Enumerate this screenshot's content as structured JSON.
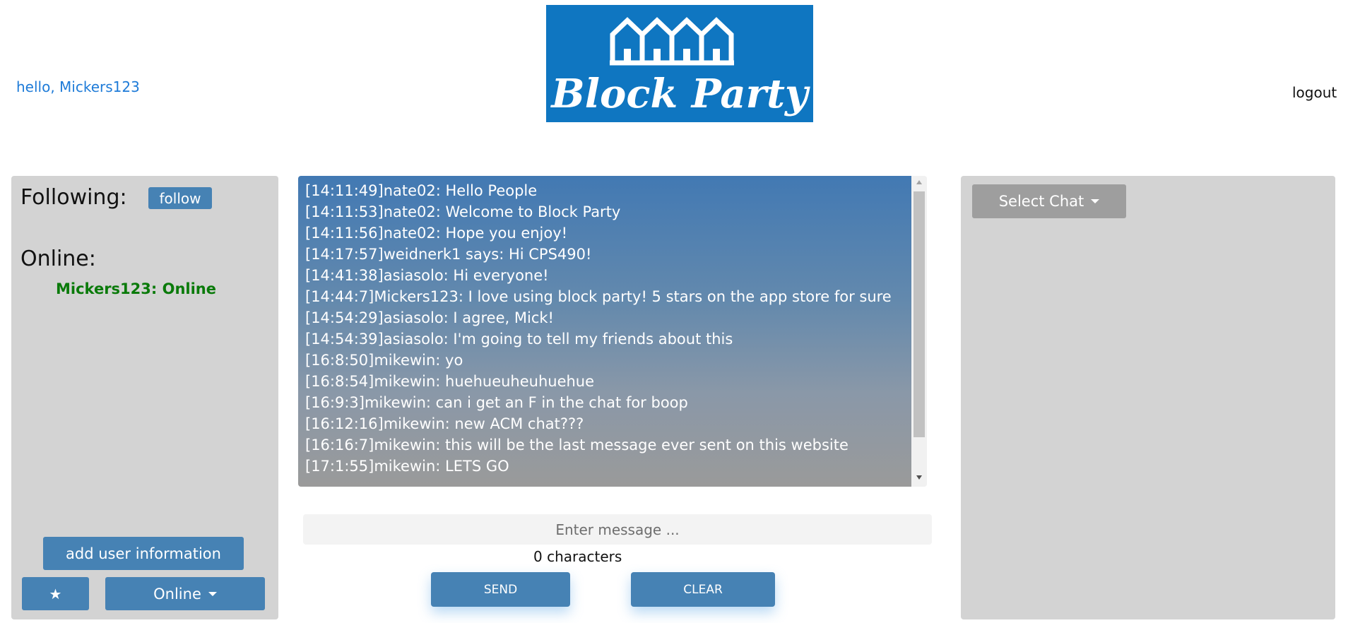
{
  "header": {
    "greeting": "hello, Mickers123",
    "logo_text": "Block Party",
    "logout_label": "logout"
  },
  "left_panel": {
    "following_title": "Following:",
    "follow_label": "follow",
    "online_title": "Online:",
    "online_users": [
      "Mickers123: Online"
    ],
    "add_info_label": "add user information",
    "star_label": "★",
    "status_label": "Online"
  },
  "chat": {
    "messages": [
      "[14:11:49]nate02: Hello People",
      "[14:11:53]nate02: Welcome to Block Party",
      "[14:11:56]nate02: Hope you enjoy!",
      "[14:17:57]weidnerk1 says: Hi CPS490!",
      "[14:41:38]asiasolo: Hi everyone!",
      "[14:44:7]Mickers123: I love using block party! 5 stars on the app store for sure",
      "[14:54:29]asiasolo: I agree, Mick!",
      "[14:54:39]asiasolo: I'm going to tell my friends about this",
      "[16:8:50]mikewin: yo",
      "[16:8:54]mikewin: huehueuheuhuehue",
      "[16:9:3]mikewin: can i get an F in the chat for boop",
      "[16:12:16]mikewin: new ACM chat???",
      "[16:16:7]mikewin: this will be the last message ever sent on this website",
      "[17:1:55]mikewin: LETS GO"
    ],
    "input_placeholder": "Enter message ...",
    "char_count": "0 characters",
    "send_label": "SEND",
    "clear_label": "CLEAR"
  },
  "right_panel": {
    "select_chat_label": "Select Chat"
  },
  "colors": {
    "accent": "#4682b4",
    "logo_bg": "#0f76c1",
    "panel_bg": "#d3d3d3",
    "online_green": "#0a7a0a",
    "greeting_blue": "#1e7bd8"
  },
  "icons": {
    "star": "star-icon",
    "caret": "chevron-down-icon",
    "houses": "houses-icon"
  }
}
